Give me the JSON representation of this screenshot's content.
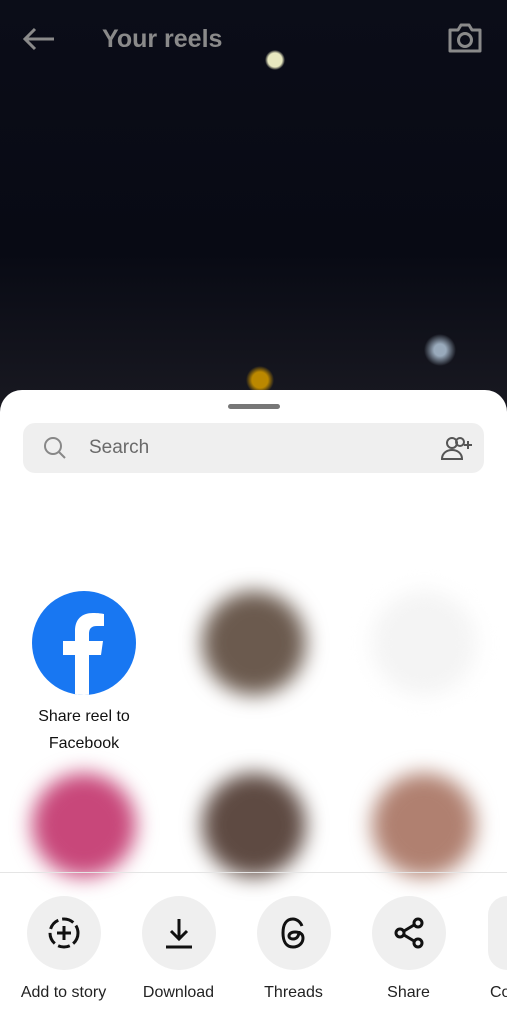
{
  "header": {
    "title": "Your reels",
    "back_icon": "arrow-left-icon",
    "camera_icon": "camera-icon"
  },
  "search": {
    "placeholder": "Search"
  },
  "share_targets": [
    {
      "label": "Share reel to Facebook",
      "brand_color": "#1877f2"
    }
  ],
  "actions": [
    {
      "label": "Add to story",
      "icon": "add-story-icon"
    },
    {
      "label": "Download",
      "icon": "download-icon"
    },
    {
      "label": "Threads",
      "icon": "threads-icon"
    },
    {
      "label": "Share",
      "icon": "share-icon"
    },
    {
      "label": "Co",
      "icon": "copy-link-icon"
    }
  ]
}
